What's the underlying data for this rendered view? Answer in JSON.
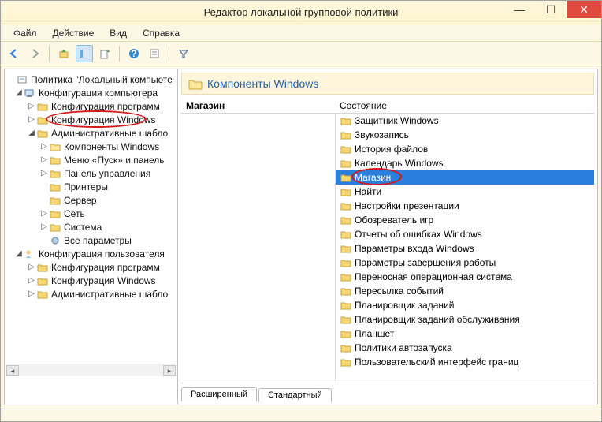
{
  "window": {
    "title": "Редактор локальной групповой политики"
  },
  "menu": {
    "file": "Файл",
    "action": "Действие",
    "view": "Вид",
    "help": "Справка"
  },
  "tree": {
    "root": "Политика \"Локальный компьюте",
    "compCfg": "Конфигурация компьютера",
    "cfgProg1": "Конфигурация программ",
    "cfgWin1": "Конфигурация Windows",
    "admTmpl1": "Административные шабло",
    "winComp": "Компоненты Windows",
    "startMenu": "Меню «Пуск» и панель",
    "ctrlPanel": "Панель управления",
    "printers": "Принтеры",
    "server": "Сервер",
    "net": "Сеть",
    "system": "Система",
    "allParams": "Все параметры",
    "userCfg": "Конфигурация пользователя",
    "cfgProg2": "Конфигурация программ",
    "cfgWin2": "Конфигурация Windows",
    "admTmpl2": "Административные шабло"
  },
  "header": {
    "title": "Компоненты Windows"
  },
  "columns": {
    "left": "Магазин",
    "right": "Состояние"
  },
  "list": [
    "Защитник Windows",
    "Звукозапись",
    "История файлов",
    "Календарь Windows",
    "Магазин",
    "Найти",
    "Настройки презентации",
    "Обозреватель игр",
    "Отчеты об ошибках Windows",
    "Параметры входа Windows",
    "Параметры завершения работы",
    "Переносная операционная система",
    "Пересылка событий",
    "Планировщик заданий",
    "Планировщик заданий обслуживания",
    "Планшет",
    "Политики автозапуска",
    "Пользовательский интерфейс границ"
  ],
  "tabs": {
    "ext": "Расширенный",
    "std": "Стандартный"
  }
}
